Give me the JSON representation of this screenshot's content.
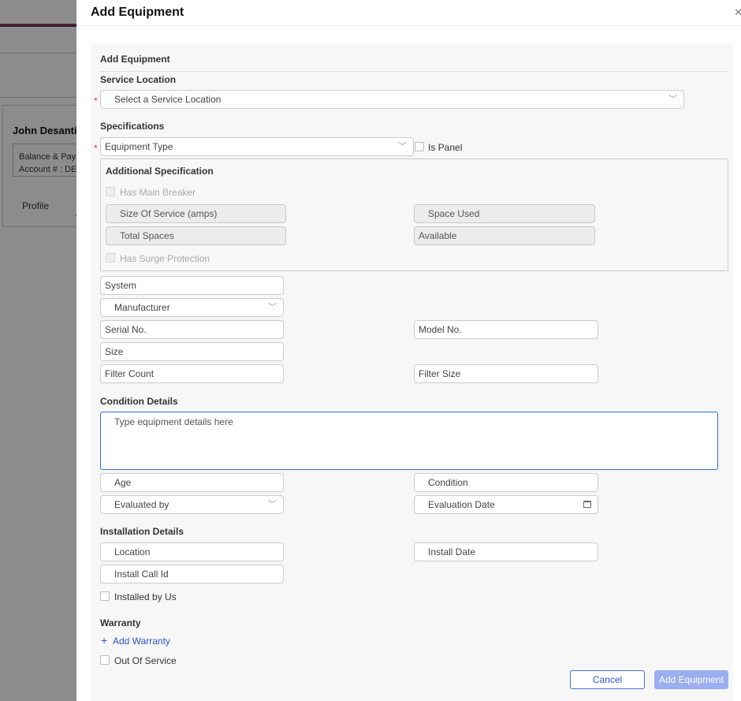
{
  "background": {
    "customer_name": "John Desantis",
    "balance_text": "Balance & Paym",
    "account_text": "Account # : DES",
    "profile_tab": "Profile"
  },
  "drawer": {
    "title": "Add Equipment",
    "close_icon": "close-icon"
  },
  "form": {
    "section_title": "Add Equipment",
    "service_location": {
      "label": "Service Location",
      "placeholder": "Select a Service Location"
    },
    "specifications": {
      "label": "Specifications",
      "equipment_type": "Equipment Type",
      "is_panel": "Is Panel"
    },
    "additional_spec": {
      "label": "Additional Specification",
      "has_main_breaker": "Has Main Breaker",
      "size_of_service": "Size Of Service (amps)",
      "space_used": "Space Used",
      "total_spaces": "Total Spaces",
      "available": "Available",
      "has_surge_protection": "Has Surge Protection"
    },
    "system": "System",
    "manufacturer": "Manufacturer",
    "serial_no": "Serial No.",
    "model_no": "Model No.",
    "size": "Size",
    "filter_count": "Filter Count",
    "filter_size": "Filter Size",
    "condition_details": {
      "label": "Condition Details",
      "placeholder": "Type equipment details here",
      "age": "Age",
      "condition": "Condition",
      "evaluated_by": "Evaluated by",
      "evaluation_date": "Evaluation Date"
    },
    "installation_details": {
      "label": "Installation Details",
      "location": "Location",
      "install_date": "Install Date",
      "install_call_id": "Install Call Id",
      "installed_by_us": "Installed by Us"
    },
    "warranty": {
      "label": "Warranty",
      "add_warranty": "Add Warranty"
    },
    "out_of_service": "Out Of Service",
    "cancel_button": "Cancel",
    "add_button": "Add Equipment"
  }
}
